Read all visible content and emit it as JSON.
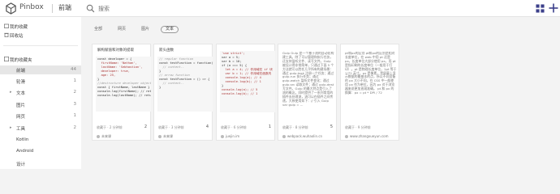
{
  "header": {
    "app_name": "Pinbox",
    "category": "前端",
    "search_placeholder": "搜索"
  },
  "sidebar": {
    "top_items": [
      {
        "label": "我的收藏"
      },
      {
        "label": "回收站"
      }
    ],
    "section_label": "我的收藏夹",
    "items": [
      {
        "label": "前端",
        "count": "44",
        "active": true
      },
      {
        "label": "轮滑",
        "count": "1"
      },
      {
        "label": "文本",
        "count": "2"
      },
      {
        "label": "图片",
        "count": "3"
      },
      {
        "label": "网页",
        "count": "1"
      },
      {
        "label": "工具",
        "count": "2"
      },
      {
        "label": "Kotlin",
        "count": ""
      },
      {
        "label": "Android",
        "count": ""
      },
      {
        "label": "设计",
        "count": ""
      }
    ]
  },
  "filters": [
    {
      "label": "全部"
    },
    {
      "label": "网页"
    },
    {
      "label": "图片"
    },
    {
      "label": "文本",
      "active": true
    }
  ],
  "cards": [
    {
      "title": "解构赋值和对象的提取",
      "code": [
        "const developer = {",
        "  firstName: 'Nathan',",
        "  lastName: 'Sebhastian',",
        "  developer: true,",
        "  age: 25,",
        "}",
        "",
        "//destructure developer object",
        "const { firstName, lastName } =",
        "console.log(firstName); // retu",
        "console.log(lastName); // retu"
      ],
      "meta": "收藏于 · 2 分钟前",
      "count": "2",
      "source": "未来课"
    },
    {
      "title": "箭头函数",
      "code": [
        "// regular function",
        "const testFunction = function(",
        "  // content..",
        "}",
        "",
        "// arrow function",
        "const testFunction = () => {",
        "  // content..",
        "}"
      ],
      "meta": "收藏于 · 3 分钟前",
      "count": "4",
      "source": "未来课"
    },
    {
      "title": "",
      "code": [
        "'use strict';",
        "var a = 5;",
        "var b = 10;",
        "if (a === 5) {",
        "  let a = 4; // 作用域在 if 块",
        "  var b = 1; // 作用域在函数内",
        "  console.log(a); // 4",
        "  console.log(b); // 1",
        "}",
        "console.log(a); // 5",
        "console.log(b); // 1"
      ],
      "meta": "收藏于 · 6 分钟前",
      "count": "1",
      "source": "juejin.im"
    },
    {
      "title": "",
      "text": "Gulp Gulp 是一个基于流的自动化构建工具。除了可以管理和执行任务，还支持监听文件、读写文件。Gulp 被设计得非常简单，只通过下面 5 个方法就可以胜任几乎所有构建场景：通过 gulp.task 注册一个任务；通过 gulp.run 执行任务；通过 gulp.watch 监听文件变化；通过 gulp.src 读取文件；通过 gulp.dest 写文件。Gulp 的最大特点是引入了流的概念，同时提供了一系列常用的插件去处理流，流可以在插件之间传递。大致使用如下：// 引入 Gulp var gulp = ...",
      "meta": "收藏于 · 8 分钟前",
      "count": "5",
      "source": "webpack.wuhaolin.cn"
    },
    {
      "title": "",
      "text": "pt和px的区别 pt和px的区别是相对长度单位，在 web 中用 pt 还是 px，长度单位大部分使用 px，而 pt 是指印刷的长度单位（一般用于打印）。pt 是物理长度单位，1pt 等于 1/72 英寸。px 是像素，是屏幕上显示数据的最基本的点，所以不同设备的 px 大小不同。在 CSS 中一般使用 px 作为单位，因为 px 对于浏览器来说更加直观准确。 pt 和 px 的换算：px = pt * DPI / 72",
      "meta": "收藏于 · 9 分钟前",
      "count": "",
      "source": "www.zhangxueyun.com"
    }
  ]
}
